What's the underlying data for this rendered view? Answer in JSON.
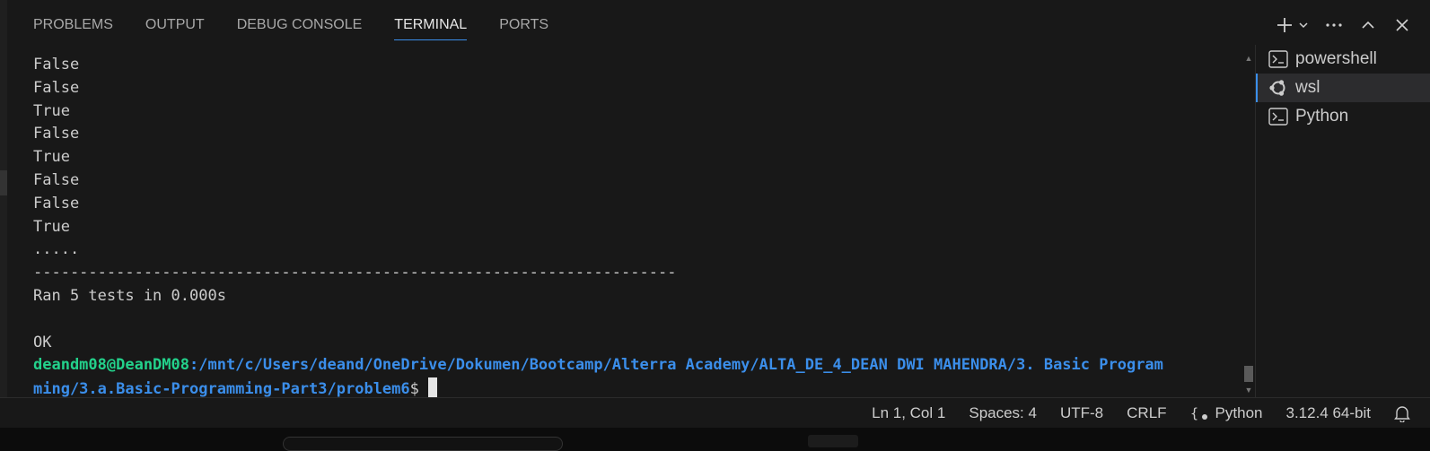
{
  "tabs": [
    {
      "label": "PROBLEMS"
    },
    {
      "label": "OUTPUT"
    },
    {
      "label": "DEBUG CONSOLE"
    },
    {
      "label": "TERMINAL",
      "active": true
    },
    {
      "label": "PORTS"
    }
  ],
  "terminal": {
    "output_lines": [
      "False",
      "False",
      "True",
      "False",
      "True",
      "False",
      "False",
      "True",
      ".....",
      "----------------------------------------------------------------------",
      "Ran 5 tests in 0.000s",
      "",
      "OK"
    ],
    "prompt_user": "deandm08@DeanDM08",
    "prompt_path_1": ":/mnt/c/Users/deand/OneDrive/Dokumen/Bootcamp/Alterra Academy/ALTA_DE_4_DEAN DWI MAHENDRA/3. Basic Program",
    "prompt_path_2": "ming/3.a.Basic-Programming-Part3/problem6",
    "prompt_symbol": "$"
  },
  "terminal_list": [
    {
      "name": "powershell",
      "icon": "terminal-icon"
    },
    {
      "name": "wsl",
      "icon": "ubuntu-icon",
      "active": true
    },
    {
      "name": "Python",
      "icon": "terminal-icon"
    }
  ],
  "statusbar": {
    "position": "Ln 1, Col 1",
    "spaces": "Spaces: 4",
    "encoding": "UTF-8",
    "eol": "CRLF",
    "language": "Python",
    "interpreter": "3.12.4 64-bit"
  },
  "colors": {
    "accent": "#3b8eea",
    "prompt_user": "#23d18b",
    "prompt_path": "#3b8eea",
    "background": "#181818"
  }
}
